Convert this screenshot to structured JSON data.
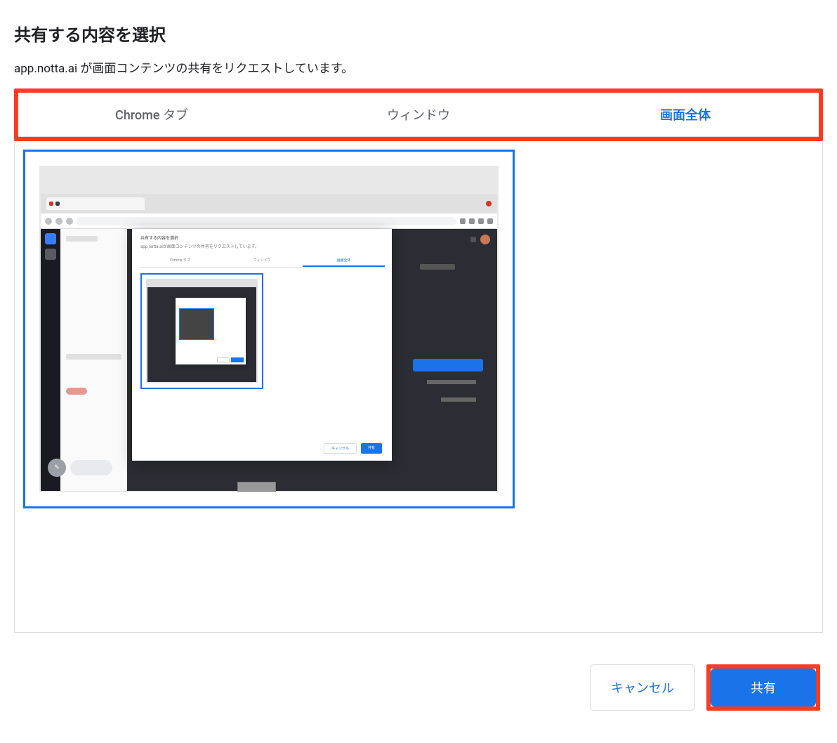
{
  "dialog": {
    "title": "共有する内容を選択",
    "subtitle": "app.notta.ai が画面コンテンツの共有をリクエストしています。"
  },
  "tabs": {
    "chrome_tab": "Chrome タブ",
    "window": "ウィンドウ",
    "entire_screen": "画面全体"
  },
  "inner_dialog": {
    "title": "共有する内容を選択",
    "subtitle": "app.notta.aiが画面コンテンツの共有をリクエストしています。",
    "tab1": "Chrome タブ",
    "tab2": "ウィンドウ",
    "tab3": "画面全体",
    "cancel": "キャンセル",
    "share": "共有"
  },
  "buttons": {
    "cancel": "キャンセル",
    "share": "共有"
  },
  "colors": {
    "highlight": "#ff3b1f",
    "primary": "#1a73e8"
  }
}
